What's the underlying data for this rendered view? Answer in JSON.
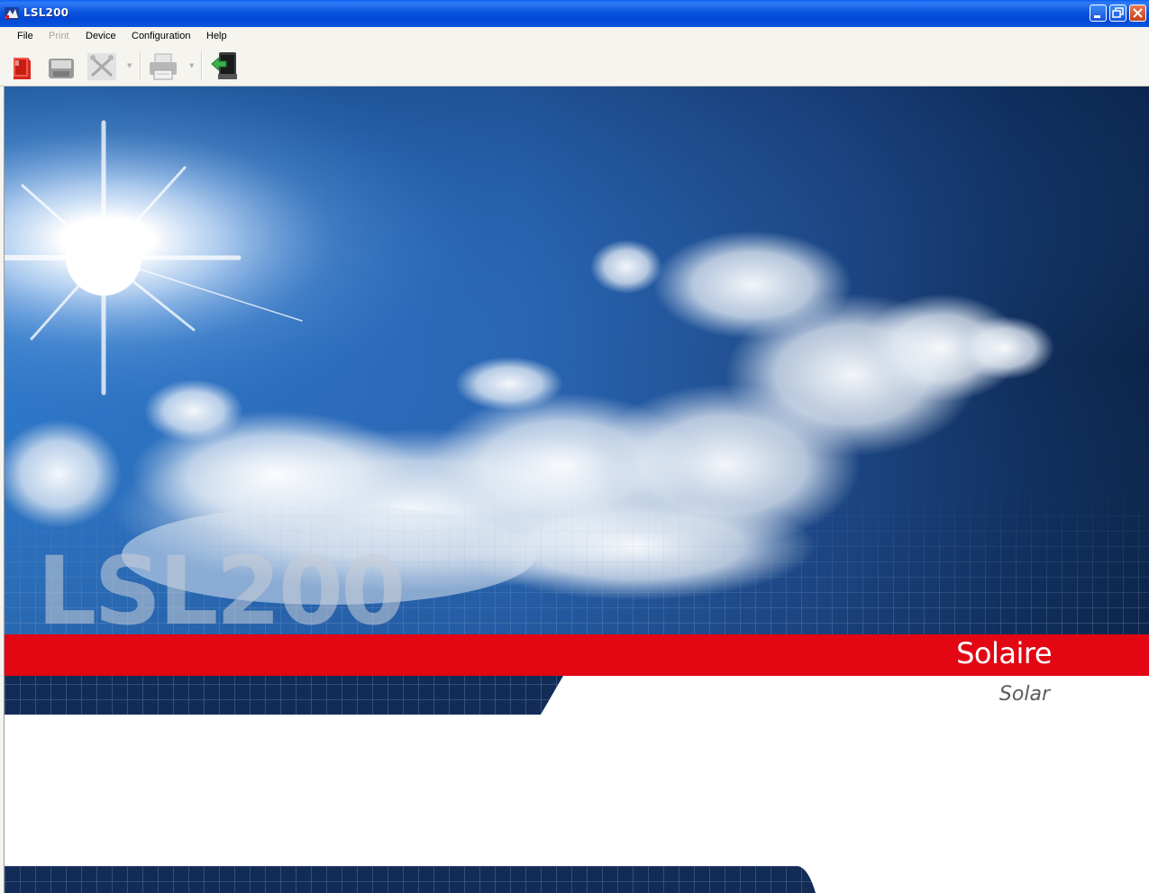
{
  "window": {
    "title": "LSL200"
  },
  "menu": {
    "items": [
      {
        "label": "File",
        "enabled": true
      },
      {
        "label": "Print",
        "enabled": false
      },
      {
        "label": "Device",
        "enabled": true
      },
      {
        "label": "Configuration",
        "enabled": true
      },
      {
        "label": "Help",
        "enabled": true
      }
    ]
  },
  "toolbar": {
    "buttons": [
      {
        "icon": "open-file-icon",
        "enabled": true
      },
      {
        "icon": "save-icon",
        "enabled": false
      },
      {
        "icon": "tools-icon",
        "enabled": false
      },
      {
        "icon": "print-icon",
        "enabled": false
      },
      {
        "icon": "exit-icon",
        "enabled": true
      }
    ]
  },
  "banner": {
    "product_name": "LSL200",
    "title_fr": "Solaire",
    "title_en": "Solar"
  },
  "colors": {
    "titlebar": "#0a55e0",
    "accent_red": "#e30613",
    "navy": "#0e2a55",
    "sky": "#2c6fc0"
  }
}
